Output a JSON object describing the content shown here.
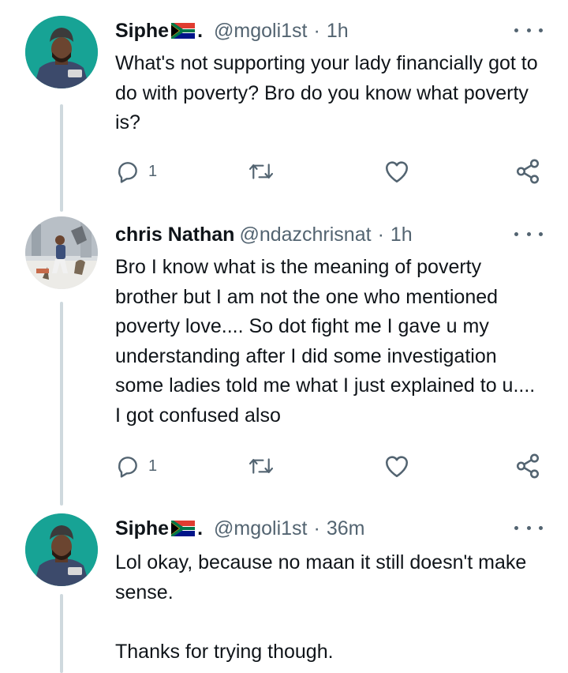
{
  "tweets": [
    {
      "display_name": "Siphe",
      "name_suffix": ".",
      "flag_icon": "south-africa-flag-icon",
      "handle": "@mgoli1st",
      "separator": "·",
      "time": "1h",
      "text": "What's not supporting your lady financially got to do with poverty? Bro do you know what poverty is?",
      "reply_count": "1",
      "retweet_count": "",
      "like_count": ""
    },
    {
      "display_name": "chris Nathan",
      "handle": "@ndazchrisnat",
      "separator": "·",
      "time": "1h",
      "text": "Bro I know what is the meaning of poverty brother but I am not the one who mentioned poverty love.... So dot fight me I gave u my understanding after I did some investigation some ladies told me what I just explained to u.... I got confused also",
      "reply_count": "1",
      "retweet_count": "",
      "like_count": ""
    },
    {
      "display_name": "Siphe",
      "name_suffix": ".",
      "flag_icon": "south-africa-flag-icon",
      "handle": "@mgoli1st",
      "separator": "·",
      "time": "36m",
      "text": "Lol okay, because no maan it still doesn't make sense.\n\nThanks for trying though."
    }
  ],
  "colors": {
    "text": "#0f1419",
    "secondary": "#536471",
    "thread_line": "#cfd9de",
    "background": "#ffffff"
  },
  "icons": [
    "reply-icon",
    "retweet-icon",
    "like-icon",
    "share-icon",
    "more-options-icon"
  ]
}
